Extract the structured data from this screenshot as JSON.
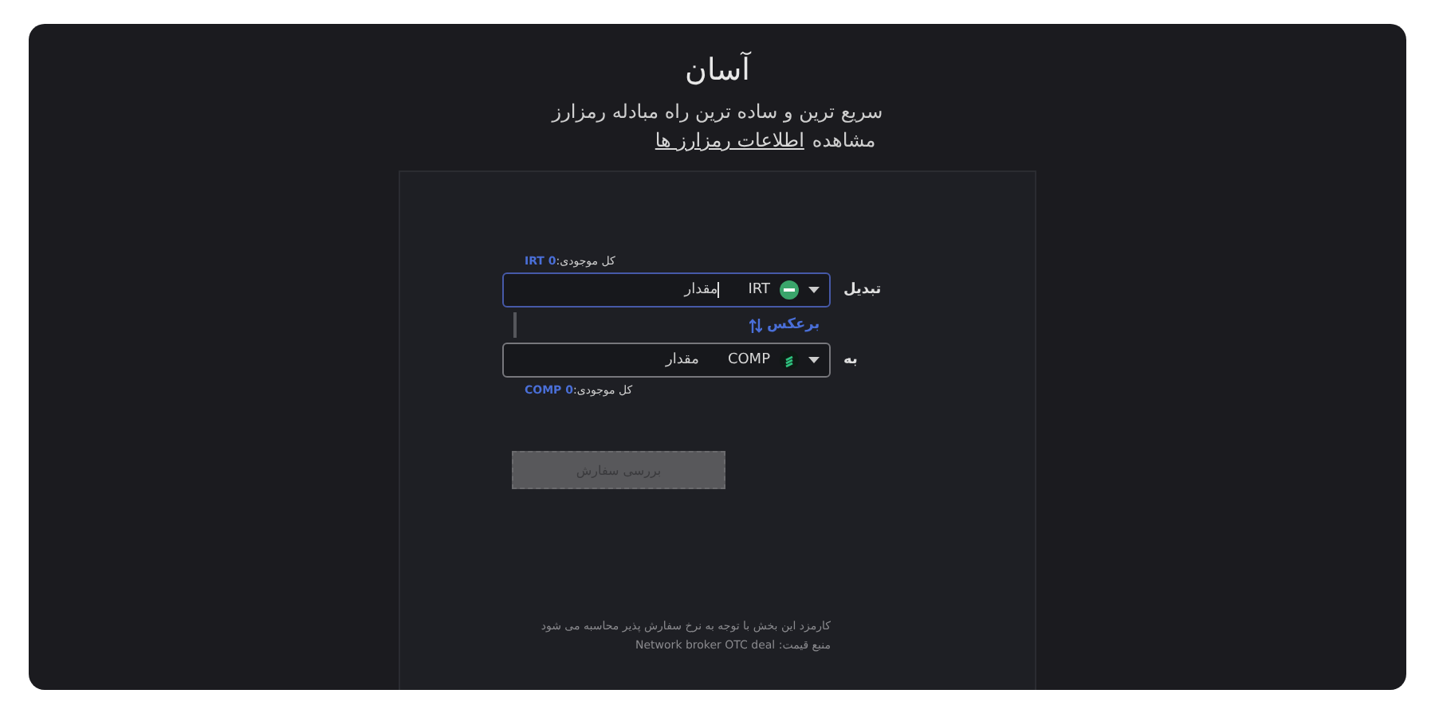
{
  "header": {
    "title": "آسان",
    "subtitle": "سریع ترین و ساده ترین راه مبادله رمزارز",
    "info": "مشاهده",
    "info_link": "اطلاعات رمزارز ها"
  },
  "swap": {
    "from": {
      "label": "تبدیل",
      "balance_label": "کل موجودی:",
      "balance": "IRT 0",
      "currency": "IRT",
      "placeholder": "مقدار",
      "focused": true,
      "kind": "irt"
    },
    "reverse": "برعکس",
    "to": {
      "label": "به",
      "balance_label": "کل موجودی:",
      "balance": "COMP 0",
      "currency": "COMP",
      "placeholder": "مقدار",
      "focused": false,
      "kind": "comp"
    },
    "button": {
      "label": "بررسی سفارش",
      "disabled": true
    }
  },
  "notes": [
    "کارمزد این بخش با توجه به نرخ سفارش پذیر محاسبه می شود",
    "منبع قیمت: Network broker OTC deal"
  ]
}
